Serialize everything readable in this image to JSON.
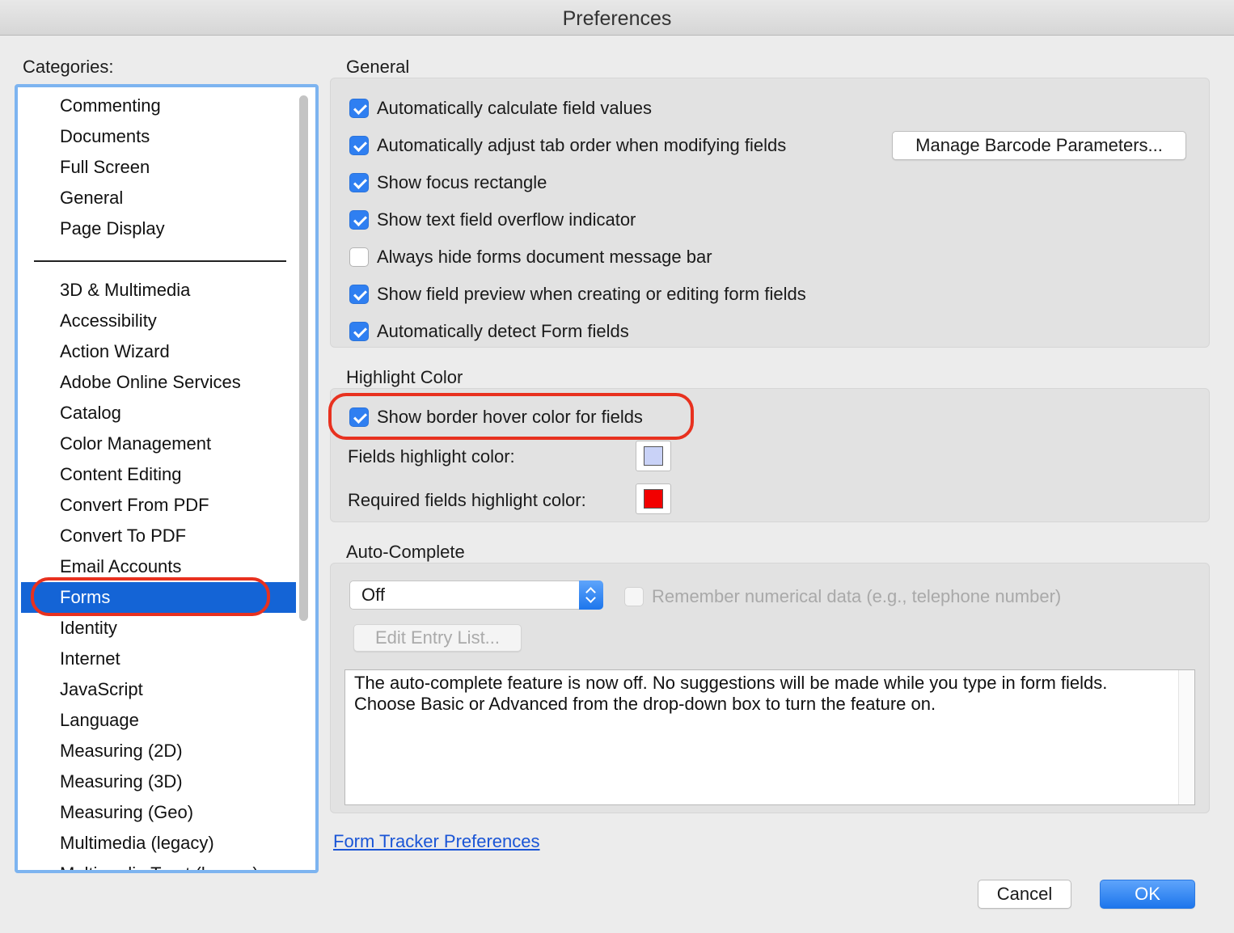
{
  "window": {
    "title": "Preferences"
  },
  "categories": {
    "label": "Categories:",
    "items": [
      "Commenting",
      "Documents",
      "Full Screen",
      "General",
      "Page Display",
      "3D & Multimedia",
      "Accessibility",
      "Action Wizard",
      "Adobe Online Services",
      "Catalog",
      "Color Management",
      "Content Editing",
      "Convert From PDF",
      "Convert To PDF",
      "Email Accounts",
      "Forms",
      "Identity",
      "Internet",
      "JavaScript",
      "Language",
      "Measuring (2D)",
      "Measuring (3D)",
      "Measuring (Geo)",
      "Multimedia (legacy)",
      "Multimedia Trust (legacy)"
    ],
    "selected": "Forms"
  },
  "general": {
    "title": "General",
    "options": [
      {
        "label": "Automatically calculate field values",
        "checked": true
      },
      {
        "label": "Automatically adjust tab order when modifying fields",
        "checked": true
      },
      {
        "label": "Show focus rectangle",
        "checked": true
      },
      {
        "label": "Show text field overflow indicator",
        "checked": true
      },
      {
        "label": "Always hide forms document message bar",
        "checked": false
      },
      {
        "label": "Show field preview when creating or editing form fields",
        "checked": true
      },
      {
        "label": "Automatically detect Form fields",
        "checked": true
      }
    ],
    "barcode_button": "Manage Barcode Parameters..."
  },
  "highlight": {
    "title": "Highlight Color",
    "border_hover": {
      "label": "Show border hover color for fields",
      "checked": true
    },
    "fields_color_label": "Fields highlight color:",
    "fields_color": "#c9d2f7",
    "required_color_label": "Required fields highlight color:",
    "required_color": "#f20000"
  },
  "autocomplete": {
    "title": "Auto-Complete",
    "mode": "Off",
    "remember_numeric": {
      "label": "Remember numerical data (e.g., telephone number)",
      "checked": false
    },
    "edit_list_button": "Edit Entry List...",
    "description_line1": "The auto-complete feature is now off. No suggestions will be made while you type in form fields.",
    "description_line2": "Choose Basic or Advanced from the drop-down box to turn the feature on."
  },
  "form_tracker_link": "Form Tracker Preferences",
  "footer": {
    "cancel": "Cancel",
    "ok": "OK"
  },
  "colors": {
    "accent": "#1464d6",
    "annotation": "#e8311f"
  }
}
